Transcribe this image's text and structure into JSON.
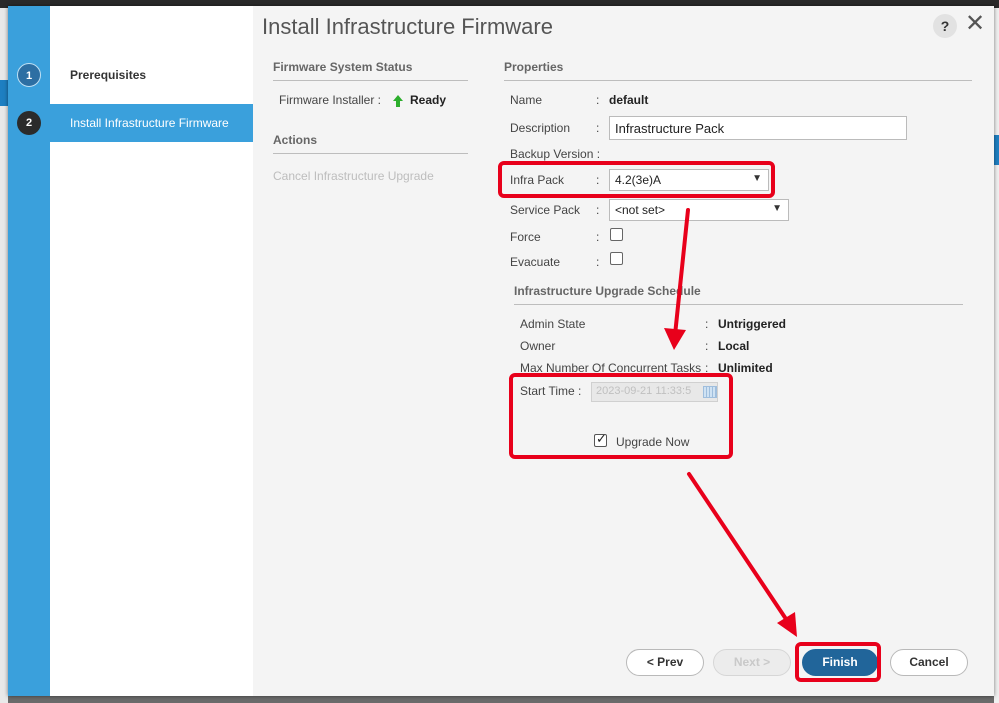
{
  "dialog": {
    "title": "Install Infrastructure Firmware",
    "help_label": "?",
    "close_label": "✕"
  },
  "steps": [
    {
      "num": "1",
      "label": "Prerequisites"
    },
    {
      "num": "2",
      "label": "Install Infrastructure Firmware"
    }
  ],
  "status": {
    "header": "Firmware System Status",
    "installer_label": "Firmware Installer :",
    "installer_icon": "green-up-arrow-icon",
    "installer_value": "Ready",
    "actions_header": "Actions",
    "cancel_action": "Cancel Infrastructure Upgrade"
  },
  "properties": {
    "header": "Properties",
    "name_label": "Name",
    "name_value": "default",
    "description_label": "Description",
    "description_value": "Infrastructure Pack",
    "backup_label": "Backup Version :",
    "infra_pack_label": "Infra Pack",
    "infra_pack_value": "4.2(3e)A",
    "service_pack_label": "Service Pack",
    "service_pack_value": "<not set>",
    "force_label": "Force",
    "force_checked": false,
    "evacuate_label": "Evacuate",
    "evacuate_checked": false,
    "colon": ":"
  },
  "schedule": {
    "header": "Infrastructure Upgrade Schedule",
    "admin_state_label": "Admin State",
    "admin_state_value": "Untriggered",
    "owner_label": "Owner",
    "owner_value": "Local",
    "max_tasks_label": "Max Number Of Concurrent Tasks",
    "max_tasks_value": "Unlimited",
    "start_time_label": "Start Time :",
    "start_time_value": "2023-09-21 11:33:5",
    "upgrade_now_label": "Upgrade Now",
    "upgrade_now_checked": true,
    "colon": ":"
  },
  "footer": {
    "prev": "< Prev",
    "next": "Next >",
    "finish": "Finish",
    "cancel": "Cancel"
  },
  "colors": {
    "highlight": "#e8001b",
    "stripe": "#3aa0dc",
    "primary_button": "#21659a"
  }
}
